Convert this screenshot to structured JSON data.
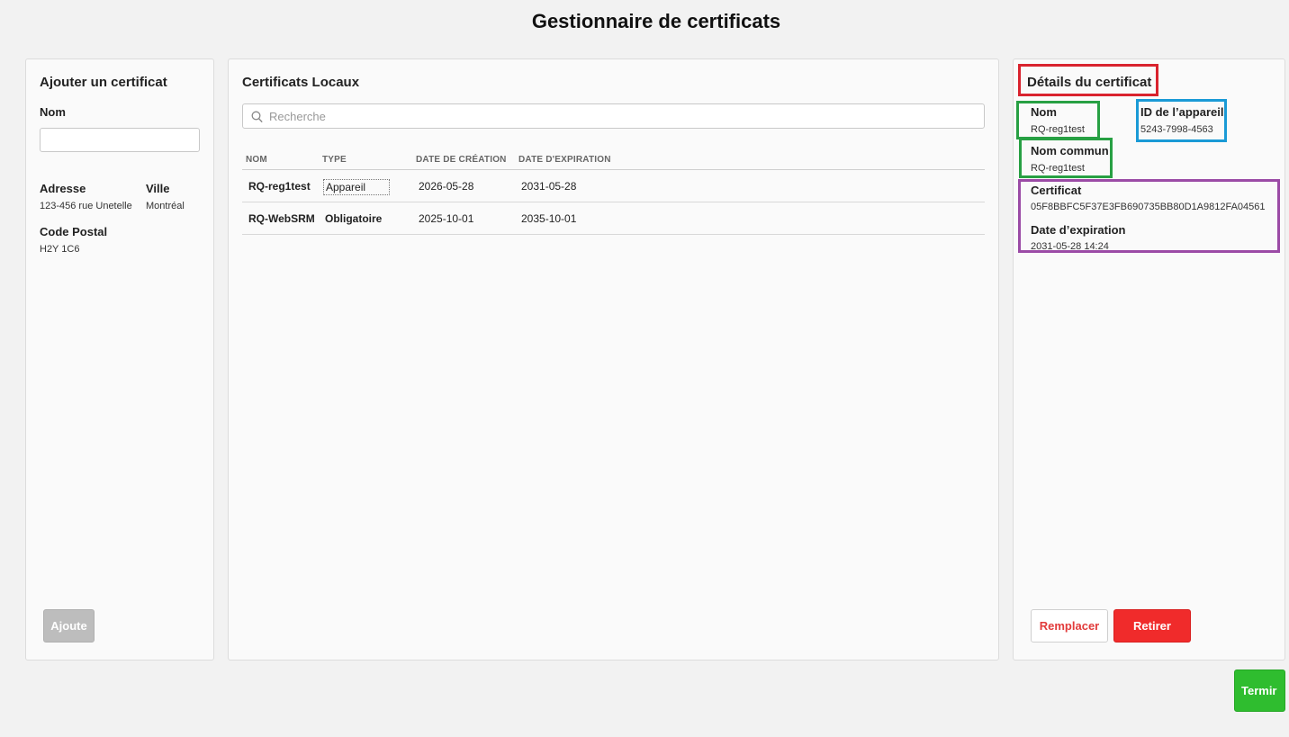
{
  "page": {
    "title": "Gestionnaire de certificats"
  },
  "add_panel": {
    "title": "Ajouter un certificat",
    "name_label": "Nom",
    "name_value": "",
    "address_label": "Adresse",
    "address_value": "123-456 rue Unetelle",
    "city_label": "Ville",
    "city_value": "Montréal",
    "postal_label": "Code Postal",
    "postal_value": "H2Y 1C6",
    "add_button": "Ajoute"
  },
  "local_panel": {
    "title": "Certificats Locaux",
    "search_placeholder": "Recherche",
    "columns": [
      "NOM",
      "TYPE",
      "DATE DE CRÉATION",
      "DATE D'EXPIRATION"
    ],
    "rows": [
      {
        "name": "RQ-reg1test",
        "type": "Appareil",
        "created": "2026-05-28",
        "expires": "2031-05-28"
      },
      {
        "name": "RQ-WebSRM",
        "type": "Obligatoire",
        "created": "2025-10-01",
        "expires": "2035-10-01"
      }
    ]
  },
  "details_panel": {
    "title": "Détails du certificat",
    "name_label": "Nom",
    "name_value": "RQ-reg1test",
    "device_id_label": "ID de l’appareil",
    "device_id_value": "5243-7998-4563",
    "common_name_label": "Nom commun",
    "common_name_value": "RQ-reg1test",
    "certificate_label": "Certificat",
    "certificate_value": "05F8BBFC5F37E3FB690735BB80D1A9812FA04561",
    "expiry_label": "Date d’expiration",
    "expiry_value": "2031-05-28 14:24",
    "replace_button": "Remplacer",
    "remove_button": "Retirer"
  },
  "finish_button": "Termir",
  "colors": {
    "highlight_red": "#d9232e",
    "highlight_green": "#27a043",
    "highlight_blue": "#1a9ad6",
    "highlight_purple": "#9b4ba6",
    "remove_red": "#f02b2b",
    "finish_green": "#2fbd2f"
  }
}
